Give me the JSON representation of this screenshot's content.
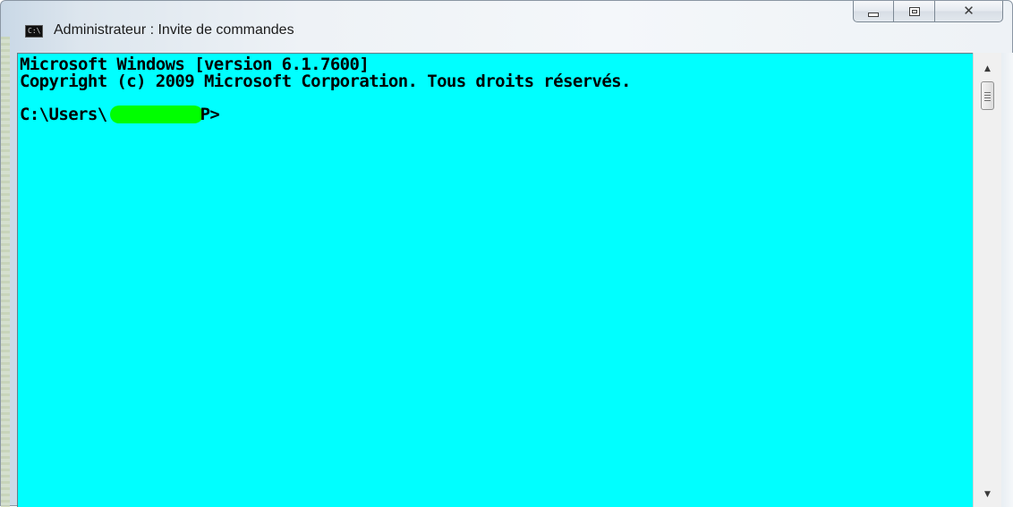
{
  "window": {
    "title": "Administrateur : Invite de commandes",
    "icon_label": "C:\\",
    "icon": "cmd-icon"
  },
  "caption_buttons": {
    "minimize_icon": "minimize-icon",
    "maximize_icon": "maximize-icon",
    "close_icon": "close-icon",
    "close_glyph": "✕"
  },
  "console": {
    "background": "#00ffff",
    "text_color": "#000000",
    "redaction_color": "#00ff00",
    "lines": [
      "Microsoft Windows [version 6.1.7600]",
      "Copyright (c) 2009 Microsoft Corporation. Tous droits réservés."
    ],
    "prompt_prefix": "C:\\Users\\",
    "prompt_suffix": "P>"
  },
  "scrollbar": {
    "up_glyph": "▲",
    "down_glyph": "▼"
  }
}
